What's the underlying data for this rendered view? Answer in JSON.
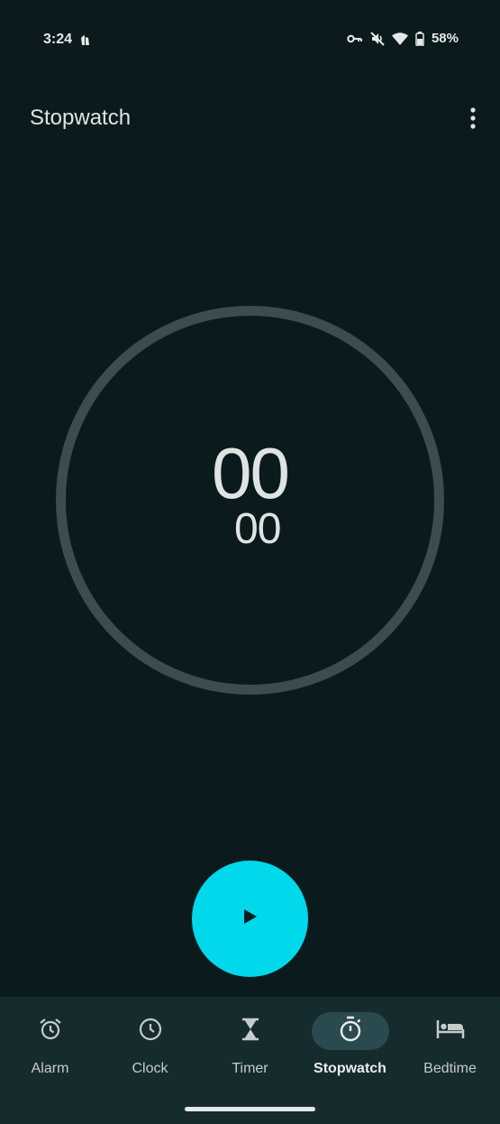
{
  "status_bar": {
    "time": "3:24",
    "battery_percent": "58%",
    "icons": [
      "notification-icon",
      "key-icon",
      "mute-icon",
      "wifi-icon",
      "battery-icon"
    ]
  },
  "header": {
    "title": "Stopwatch",
    "more_icon": "more-vert-icon"
  },
  "stopwatch": {
    "main_value": "00",
    "sub_value": "00",
    "ring_color": "#3a4d4f"
  },
  "controls": {
    "play_icon": "play-icon",
    "play_color": "#00d9eb"
  },
  "bottom_nav": {
    "items": [
      {
        "label": "Alarm",
        "icon": "alarm-icon",
        "active": false
      },
      {
        "label": "Clock",
        "icon": "clock-icon",
        "active": false
      },
      {
        "label": "Timer",
        "icon": "hourglass-icon",
        "active": false
      },
      {
        "label": "Stopwatch",
        "icon": "stopwatch-icon",
        "active": true
      },
      {
        "label": "Bedtime",
        "icon": "bed-icon",
        "active": false
      }
    ]
  }
}
